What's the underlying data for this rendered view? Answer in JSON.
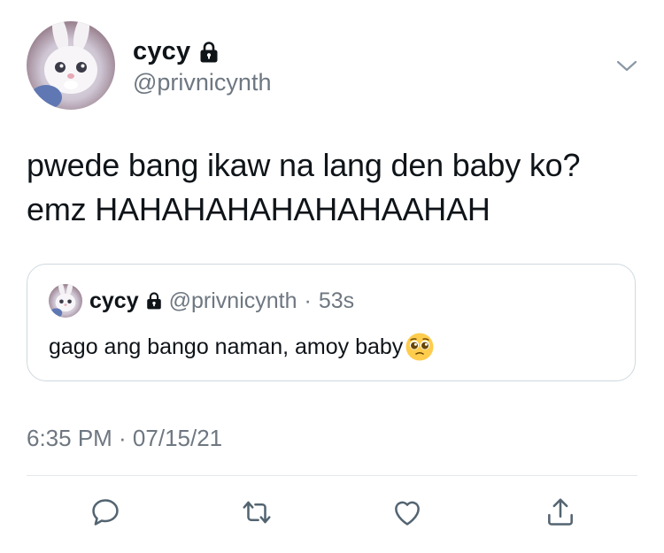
{
  "author": {
    "display_name": "cycy",
    "handle": "@privnicynth",
    "protected_icon": "lock-icon",
    "avatar_icon": "snowball-bunny-avatar"
  },
  "tweet": {
    "text": "pwede bang ikaw na lang den baby ko? emz HAHAHAHAHAHAHAAHAH",
    "timestamp": "6:35 PM · 07/15/21"
  },
  "quoted_tweet": {
    "display_name": "cycy",
    "handle": "@privnicynth",
    "separator": "·",
    "time": "53s",
    "text": "gago ang bango naman, amoy baby",
    "emoji_icon": "pleading-face-icon"
  },
  "actions": [
    {
      "name": "reply",
      "icon": "reply-icon"
    },
    {
      "name": "retweet",
      "icon": "retweet-icon"
    },
    {
      "name": "like",
      "icon": "heart-icon"
    },
    {
      "name": "share",
      "icon": "share-icon"
    }
  ],
  "colors": {
    "text_primary": "#0f1419",
    "text_secondary": "#6e7781",
    "border": "#cfd9de",
    "icon_gray": "#536471"
  }
}
